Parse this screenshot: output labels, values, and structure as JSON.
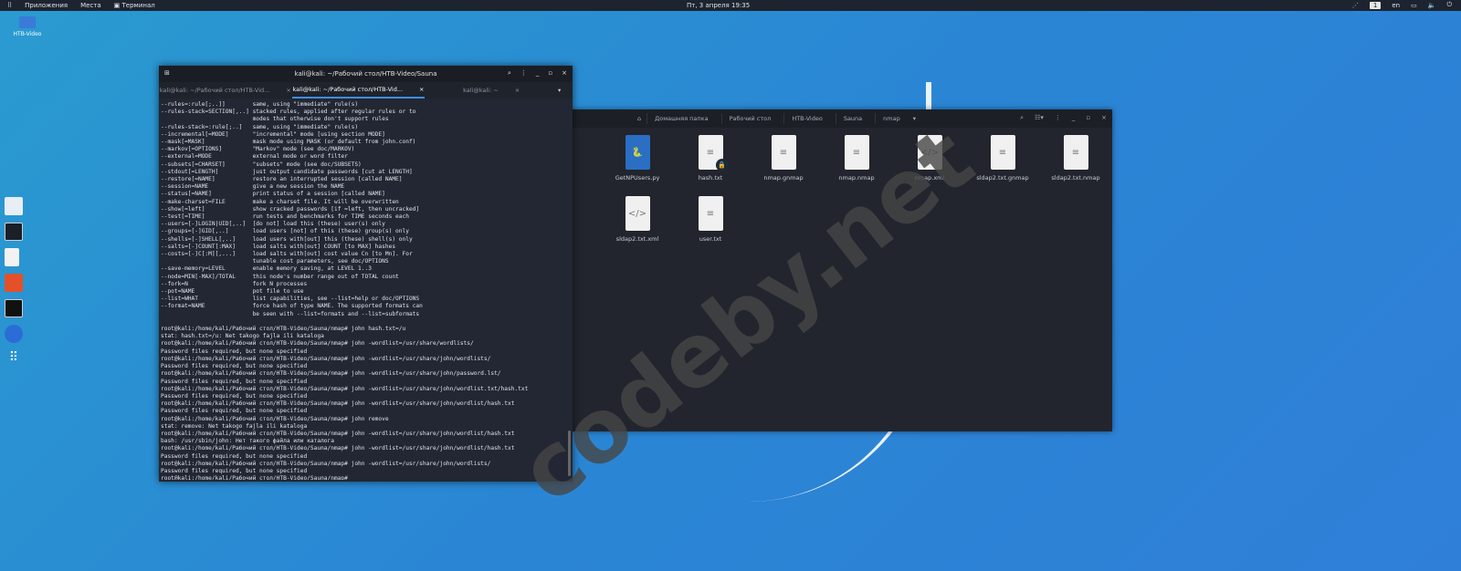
{
  "topbar": {
    "apps": "Приложения",
    "places": "Места",
    "terminal": "Терминал",
    "clock": "Пт, 3 апреля  19:35",
    "workspace": "1",
    "lang": "en"
  },
  "desktop": {
    "folder": "HTB-Video"
  },
  "dock": [
    "file-manager",
    "terminal",
    "text-editor",
    "burp",
    "terminal-2",
    "web-browser",
    "app-grid"
  ],
  "terminal": {
    "title": "kali@kali: ~/Рабочий стол/HTB-Video/Sauna",
    "tabs": [
      "kali@kali: ~/Рабочий стол/HTB-Vid...",
      "kali@kali: ~/Рабочий стол/HTB-Vid...",
      "kali@kali: ~"
    ],
    "lines": [
      "--rules=:rule[;..]]        same, using \"immediate\" rule(s)",
      "--rules-stack=SECTION[,..] stacked rules, applied after regular rules or to",
      "                           modes that otherwise don't support rules",
      "--rules-stack=:rule[;..]   same, using \"immediate\" rule(s)",
      "--incremental[=MODE]       \"incremental\" mode [using section MODE]",
      "--mask[=MASK]              mask mode using MASK (or default from john.conf)",
      "--markov[=OPTIONS]         \"Markov\" mode (see doc/MARKOV)",
      "--external=MODE            external mode or word filter",
      "--subsets[=CHARSET]        \"subsets\" mode (see doc/SUBSETS)",
      "--stdout[=LENGTH]          just output candidate passwords [cut at LENGTH]",
      "--restore[=NAME]           restore an interrupted session [called NAME]",
      "--session=NAME             give a new session the NAME",
      "--status[=NAME]            print status of a session [called NAME]",
      "--make-charset=FILE        make a charset file. It will be overwritten",
      "--show[=left]              show cracked passwords [if =left, then uncracked]",
      "--test[=TIME]              run tests and benchmarks for TIME seconds each",
      "--users=[-]LOGIN|UID[,..]  [do not] load this (these) user(s) only",
      "--groups=[-]GID[,..]       load users [not] of this (these) group(s) only",
      "--shells=[-]SHELL[,..]     load users with[out] this (these) shell(s) only",
      "--salts=[-]COUNT[:MAX]     load salts with[out] COUNT [to MAX] hashes",
      "--costs=[-]C[:M][,...]     load salts with[out] cost value Cn [to Mn]. For",
      "                           tunable cost parameters, see doc/OPTIONS",
      "--save-memory=LEVEL        enable memory saving, at LEVEL 1..3",
      "--node=MIN[-MAX]/TOTAL     this node's number range out of TOTAL count",
      "--fork=N                   fork N processes",
      "--pot=NAME                 pot file to use",
      "--list=WHAT                list capabilities, see --list=help or doc/OPTIONS",
      "--format=NAME              force hash of type NAME. The supported formats can",
      "                           be seen with --list=formats and --list=subformats",
      "",
      "root@kali:/home/kali/Рабочий стол/HTB-Video/Sauna/nmap# john hash.txt=/u",
      "stat: hash.txt=/u: Net takogo fajla ili kataloga",
      "root@kali:/home/kali/Рабочий стол/HTB-Video/Sauna/nmap# john -wordlist=/usr/share/wordlists/",
      "Password files required, but none specified",
      "root@kali:/home/kali/Рабочий стол/HTB-Video/Sauna/nmap# john -wordlist=/usr/share/john/wordlists/",
      "Password files required, but none specified",
      "root@kali:/home/kali/Рабочий стол/HTB-Video/Sauna/nmap# john -wordlist=/usr/share/john/password.lst/",
      "Password files required, but none specified",
      "root@kali:/home/kali/Рабочий стол/HTB-Video/Sauna/nmap# john -wordlist=/usr/share/john/wordlist.txt/hash.txt",
      "Password files required, but none specified",
      "root@kali:/home/kali/Рабочий стол/HTB-Video/Sauna/nmap# john -wordlist=/usr/share/john/wordlist/hash.txt",
      "Password files required, but none specified",
      "root@kali:/home/kali/Рабочий стол/HTB-Video/Sauna/nmap# john remove",
      "stat: remove: Net takogo fajla ili kataloga",
      "root@kali:/home/kali/Рабочий стол/HTB-Video/Sauna/nmap# john -wordlist=/usr/share/john/wordlist/hash.txt",
      "bash: /usr/sbin/john: Нет такого файла или каталога",
      "root@kali:/home/kali/Рабочий стол/HTB-Video/Sauna/nmap# john -wordlist=/usr/share/john/wordlist/hash.txt",
      "Password files required, but none specified",
      "root@kali:/home/kali/Рабочий стол/HTB-Video/Sauna/nmap# john -wordlist=/usr/share/john/wordlists/",
      "Password files required, but none specified",
      "root@kali:/home/kali/Рабочий стол/HTB-Video/Sauna/nmap# "
    ]
  },
  "filemanager": {
    "breadcrumb": [
      "Домашняя папка",
      "Рабочий стол",
      "HTB-Video",
      "Sauna",
      "nmap"
    ],
    "files": [
      {
        "name": "GetNPUsers.py",
        "type": "python"
      },
      {
        "name": "hash.txt",
        "type": "text-locked"
      },
      {
        "name": "nmap.gnmap",
        "type": "text"
      },
      {
        "name": "nmap.nmap",
        "type": "text"
      },
      {
        "name": "nmap.xml",
        "type": "xml"
      },
      {
        "name": "sldap2.txt.gnmap",
        "type": "text"
      },
      {
        "name": "sldap2.txt.nmap",
        "type": "text"
      },
      {
        "name": "sldap2.txt.xml",
        "type": "xml"
      },
      {
        "name": "user.txt",
        "type": "text"
      }
    ]
  },
  "watermark": "codeby.net"
}
